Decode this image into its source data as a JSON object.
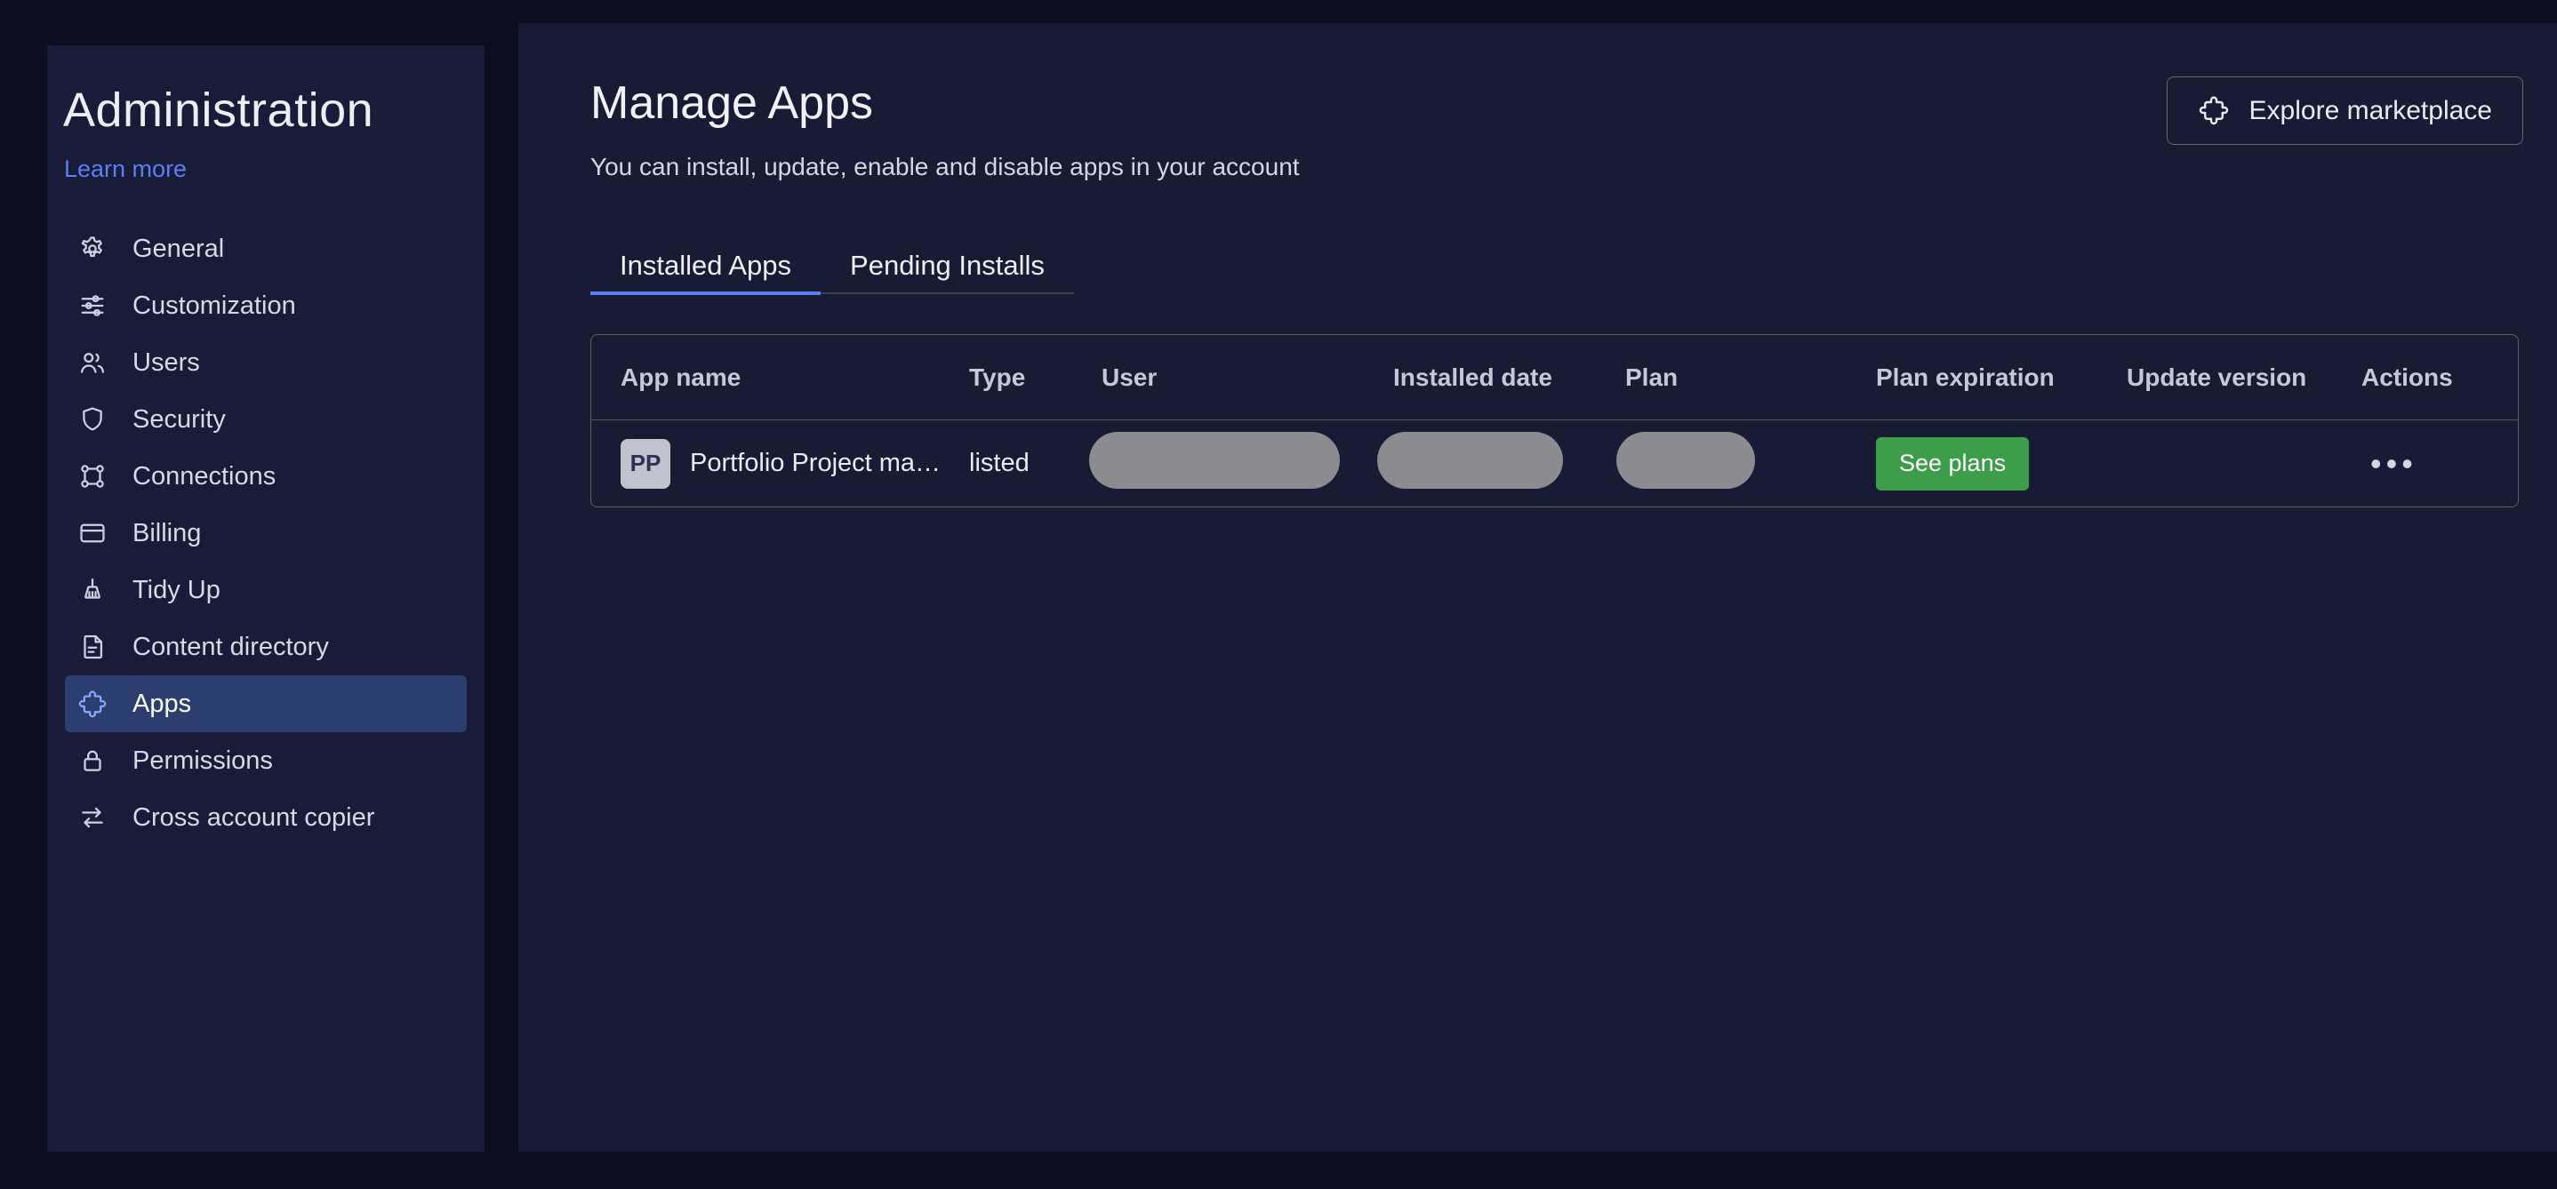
{
  "sidebar": {
    "title": "Administration",
    "learn_more": "Learn more",
    "items": [
      {
        "label": "General",
        "icon": "gear"
      },
      {
        "label": "Customization",
        "icon": "sliders"
      },
      {
        "label": "Users",
        "icon": "users"
      },
      {
        "label": "Security",
        "icon": "shield"
      },
      {
        "label": "Connections",
        "icon": "nodes"
      },
      {
        "label": "Billing",
        "icon": "credit-card"
      },
      {
        "label": "Tidy Up",
        "icon": "broom"
      },
      {
        "label": "Content directory",
        "icon": "document"
      },
      {
        "label": "Apps",
        "icon": "puzzle",
        "selected": true
      },
      {
        "label": "Permissions",
        "icon": "lock"
      },
      {
        "label": "Cross account copier",
        "icon": "arrows"
      }
    ]
  },
  "header": {
    "title": "Manage Apps",
    "subtitle": "You can install, update, enable and disable apps in your account",
    "explore_button": "Explore marketplace"
  },
  "tabs": [
    {
      "label": "Installed Apps",
      "active": true
    },
    {
      "label": "Pending Installs",
      "active": false
    }
  ],
  "table": {
    "columns": [
      "App name",
      "Type",
      "User",
      "Installed date",
      "Plan",
      "Plan expiration",
      "Update version",
      "Actions"
    ],
    "rows": [
      {
        "avatar_initials": "PP",
        "app_name": "Portfolio Project ma…",
        "type": "listed",
        "user_redacted": true,
        "installed_date_redacted": true,
        "plan_redacted": true,
        "plan_expiration_button": "See plans",
        "update_version": "",
        "actions": "•••"
      }
    ]
  },
  "colors": {
    "accent_blue": "#5b7df6",
    "green_button": "#3d9d4b",
    "redacted_gray": "#8b8b90",
    "selected_item_bg": "#2c3e70",
    "page_bg": "#0c0e1f",
    "panel_bg": "#181b34",
    "sidebar_bg": "#191c38"
  }
}
